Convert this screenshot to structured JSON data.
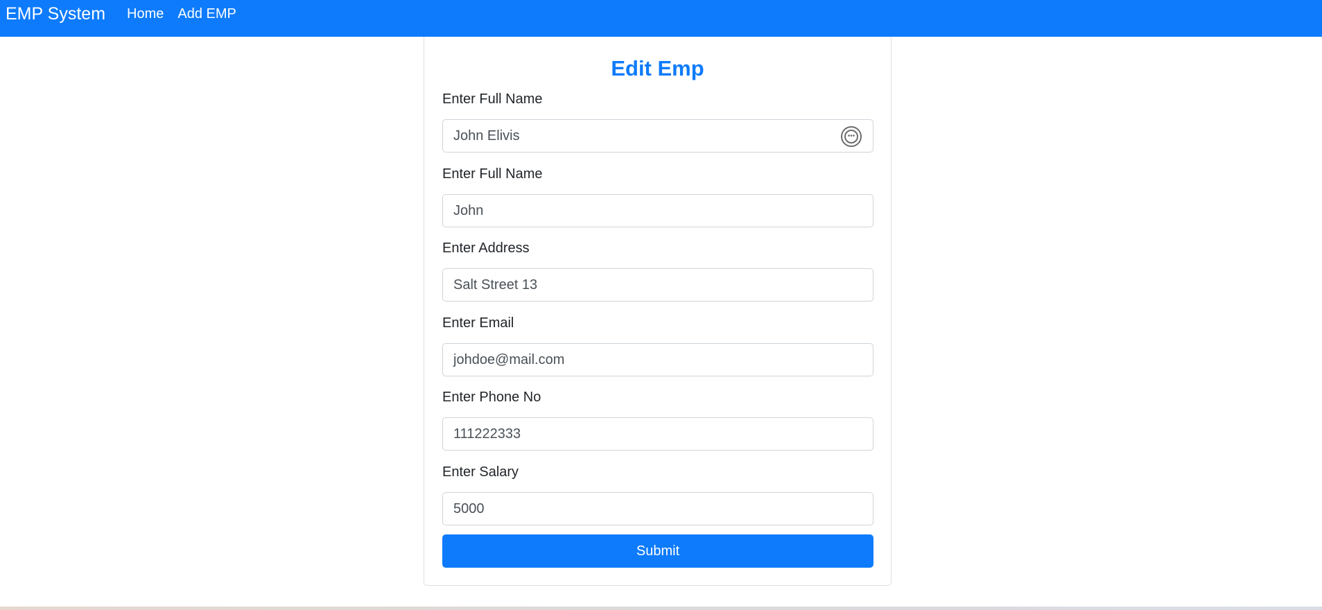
{
  "navbar": {
    "brand": "EMP System",
    "links": [
      "Home",
      "Add EMP"
    ],
    "color": "#0d7bfb"
  },
  "form": {
    "title": "Edit Emp",
    "fields": [
      {
        "label": "Enter Full Name",
        "value": "John Elivis",
        "icon": "autofill-icon"
      },
      {
        "label": "Enter Full Name",
        "value": "John"
      },
      {
        "label": "Enter Address",
        "value": "Salt Street 13"
      },
      {
        "label": "Enter Email",
        "value": "johdoe@mail.com"
      },
      {
        "label": "Enter Phone No",
        "value": "111222333"
      },
      {
        "label": "Enter Salary",
        "value": "5000"
      }
    ],
    "submit_label": "Submit"
  }
}
